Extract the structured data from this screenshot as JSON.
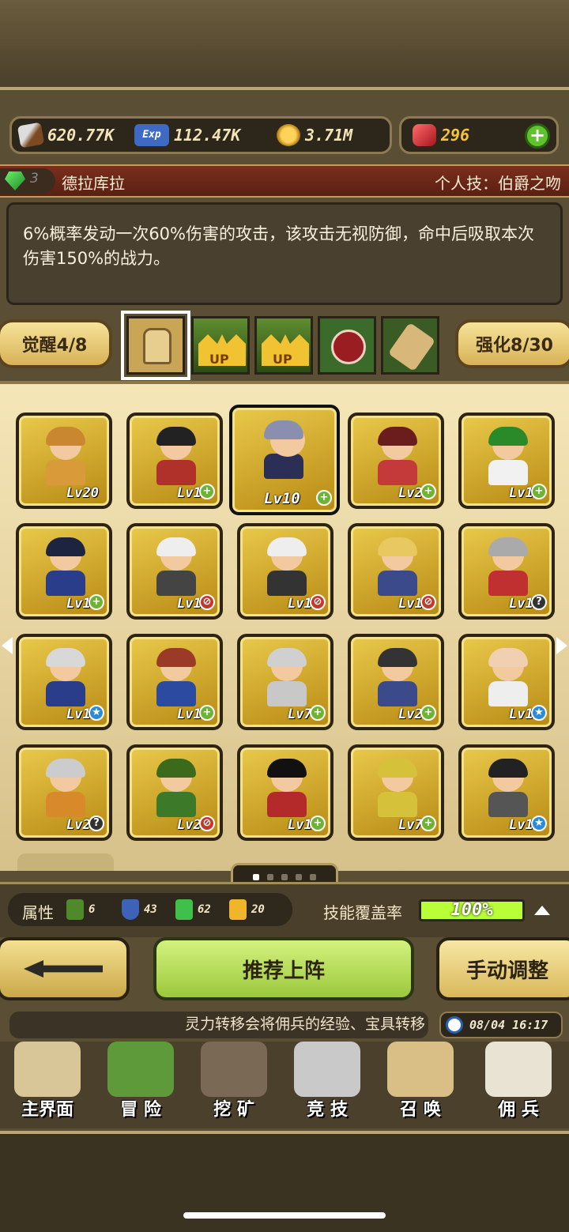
{
  "resources": {
    "attack": "620.77K",
    "exp_icon": "Exp",
    "exp": "112.47K",
    "gold": "3.71M",
    "gems": "296",
    "add": "+"
  },
  "hero": {
    "level_badge": "3",
    "name": "德拉库拉",
    "skill_label": "个人技：伯爵之吻",
    "description": "6%概率发动一次60%伤害的攻击，该攻击无视防御，命中后吸取本次伤害150%的战力。"
  },
  "awaken": {
    "label": "觉醒4/8"
  },
  "enhance": {
    "label": "强化8/30"
  },
  "skill_icons": [
    {
      "name": "arm-icon"
    },
    {
      "name": "crown-up-icon",
      "text": "UP"
    },
    {
      "name": "crown-up-icon",
      "text": "UP"
    },
    {
      "name": "mouth-icon"
    },
    {
      "name": "scroll-icon"
    }
  ],
  "heroes": [
    {
      "lv": "Lv20",
      "badge": ""
    },
    {
      "lv": "Lv16",
      "badge": "+"
    },
    {
      "lv": "Lv10",
      "badge": "+"
    },
    {
      "lv": "Lv24",
      "badge": "+"
    },
    {
      "lv": "Lv14",
      "badge": "+"
    },
    {
      "lv": "Lv14",
      "badge": "+"
    },
    {
      "lv": "Lv15",
      "badge": "⊘"
    },
    {
      "lv": "Lv14",
      "badge": "⊘"
    },
    {
      "lv": "Lv10",
      "badge": "⊘"
    },
    {
      "lv": "Lv15",
      "badge": "?"
    },
    {
      "lv": "Lv15",
      "badge": "★"
    },
    {
      "lv": "Lv11",
      "badge": "+"
    },
    {
      "lv": "Lv7",
      "badge": "+"
    },
    {
      "lv": "Lv20",
      "badge": "+"
    },
    {
      "lv": "Lv14",
      "badge": "★"
    },
    {
      "lv": "Lv27",
      "badge": "?"
    },
    {
      "lv": "Lv24",
      "badge": "⊘"
    },
    {
      "lv": "Lv12",
      "badge": "+"
    },
    {
      "lv": "Lv7",
      "badge": "+"
    },
    {
      "lv": "Lv14",
      "badge": "★"
    }
  ],
  "stats": {
    "label": "属性",
    "nature": "6",
    "shield": "43",
    "gem": "62",
    "crown": "20",
    "cover_label": "技能覆盖率",
    "cover_value": "100%",
    "cover_fraction": 1.0
  },
  "buttons": {
    "recommend": "推荐上阵",
    "manual": "手动调整"
  },
  "ticker": {
    "text": "灵力转移会将佣兵的经验、宝具转移"
  },
  "clock": {
    "text": "08/04 16:17"
  },
  "nav": [
    {
      "label": "主界面"
    },
    {
      "label": "冒 险"
    },
    {
      "label": "挖 矿"
    },
    {
      "label": "竞 技"
    },
    {
      "label": "召 唤"
    },
    {
      "label": "佣 兵"
    }
  ],
  "colors": {
    "accent_green": "#b9ff37",
    "gold_card": "#e9c94a",
    "name_bar": "#7b2e1c"
  }
}
